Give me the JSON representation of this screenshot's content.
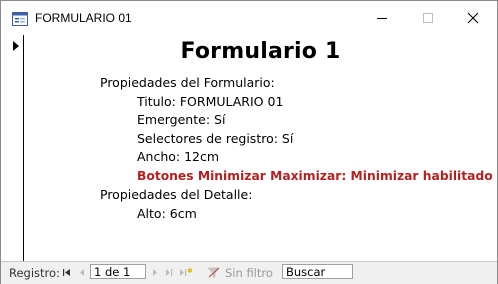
{
  "window": {
    "title": "FORMULARIO 01",
    "icon": "form-icon"
  },
  "form": {
    "heading": "Formulario 1",
    "lines": [
      "Propiedades del Formulario:",
      "Titulo: FORMULARIO 01",
      "Emergente: Sí",
      "Selectores de registro: Sí",
      "Ancho: 12cm",
      "Botones Minimizar Maximizar: Minimizar habilitado",
      "Propiedades del Detalle:",
      "Alto: 6cm"
    ]
  },
  "navigation": {
    "record_label": "Registro:",
    "record_value": "1 de 1",
    "filter_label": "Sin filtro",
    "search_value": "Buscar"
  },
  "colors": {
    "highlight": "#b22222"
  }
}
